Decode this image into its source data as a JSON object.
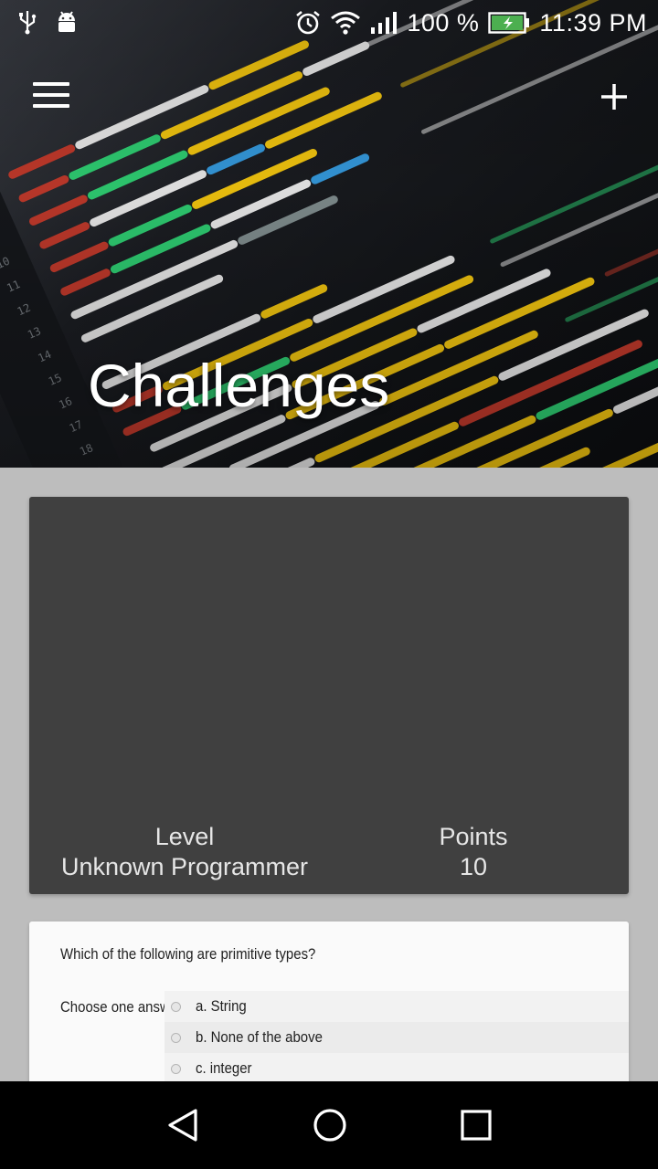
{
  "status_bar": {
    "left_icons": [
      "usb-icon",
      "android-debug-icon"
    ],
    "right_icons": [
      "alarm-icon",
      "wifi-icon",
      "signal-icon",
      "battery-charging-icon"
    ],
    "battery": "100 %",
    "time": "11:39 PM"
  },
  "app_bar": {
    "menu_icon": "menu-icon",
    "add_icon": "plus-icon",
    "title": "Challenges"
  },
  "stats": {
    "level_label": "Level",
    "level_value": "Unknown Programmer",
    "points_label": "Points",
    "points_value": "10"
  },
  "challenge": {
    "question": "Which of the following are primitive types?",
    "choose_label": "Choose one answer.",
    "answers": [
      "a. String",
      "b. None of the above",
      "c. integer"
    ]
  },
  "nav": {
    "icons": [
      "back-icon",
      "home-icon",
      "recents-icon"
    ]
  },
  "colors": {
    "page_background": "#bdbdbd",
    "stats_card": "#404040",
    "challenge_card": "#fafafa",
    "nav_bar": "#000000"
  }
}
